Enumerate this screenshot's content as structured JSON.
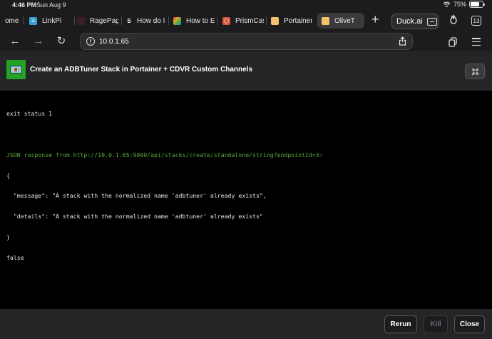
{
  "statusbar": {
    "time": "4:46 PM",
    "date": "Sun Aug 9",
    "battery": "75%",
    "battery_level": 0.75
  },
  "tabs": [
    {
      "label": "ome",
      "favicon": "",
      "color": ""
    },
    {
      "label": "LinkPi",
      "favicon": "",
      "color": "#3b9ed8"
    },
    {
      "label": "RagePag",
      "favicon": "",
      "color": "#3a1f24"
    },
    {
      "label": "How do I",
      "favicon": "S",
      "color": ""
    },
    {
      "label": "How to E",
      "favicon": "",
      "color": "#e0a030"
    },
    {
      "label": "PrismCas",
      "favicon": "",
      "color": "#d9543a"
    },
    {
      "label": "Portainer",
      "favicon": "",
      "color": "#f1c26a"
    },
    {
      "label": "OliveT",
      "favicon": "",
      "color": "#f1c26a"
    }
  ],
  "new_tab": "+",
  "duck": {
    "label": "Duck.ai"
  },
  "tab_count": "13",
  "address": {
    "url": "10.0.1.65"
  },
  "page": {
    "title": "Create an ADBTuner Stack in Portainer + CDVR Custom Channels"
  },
  "console": {
    "line1": "exit status 1",
    "line2": "JSON response from http://10.0.1.65:9000/api/stacks/create/standalone/string?endpointId=3:",
    "line3": "{",
    "line4": "  \"message\": \"A stack with the normalized name 'adbtuner' already exists\",",
    "line5": "  \"details\": \"A stack with the normalized name 'adbtuner' already exists\"",
    "line6": "}",
    "line7": "false"
  },
  "footer": {
    "rerun_label": "Rerun",
    "kill_label": "Kill",
    "close_label": "Close"
  }
}
